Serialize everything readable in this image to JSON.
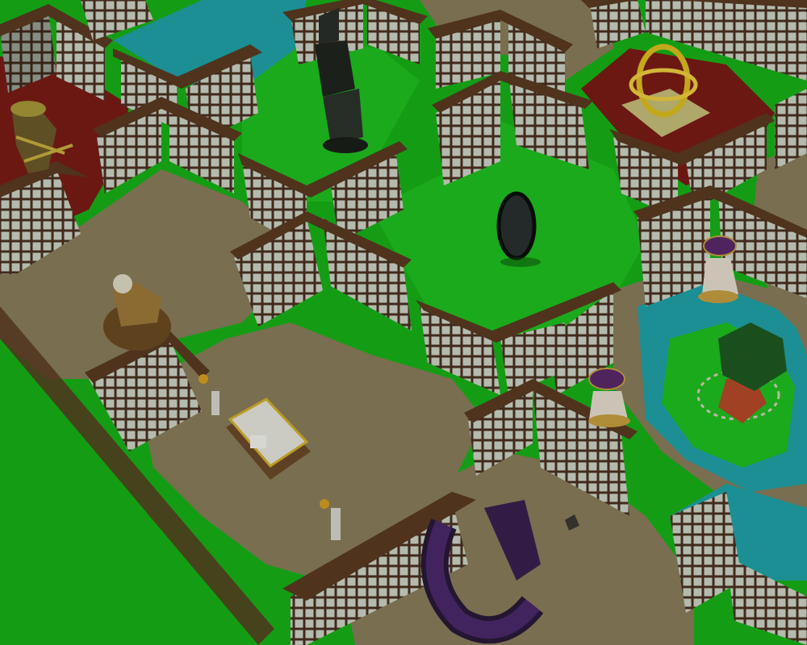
{
  "scene": {
    "view": "isometric-top-down",
    "rooms": [
      {
        "id": "red-room-west",
        "floor": "red-carpet",
        "object": "wooden-chair-statue"
      },
      {
        "id": "pool-room-north",
        "floor": "water",
        "object": null
      },
      {
        "id": "garden-room-obelisk",
        "floor": "grass",
        "object": "dark-obelisk"
      },
      {
        "id": "red-room-east",
        "floor": "red-carpet",
        "object": "golden-armillary-sphere"
      },
      {
        "id": "garden-room-mirror",
        "floor": "grass",
        "object": "dark-standing-mirror"
      },
      {
        "id": "study-room",
        "floor": "beige-stone",
        "object": "wooden-throne"
      },
      {
        "id": "workshop-room",
        "floor": "beige-stone",
        "object": "altar-table-with-lecterns"
      },
      {
        "id": "purple-room",
        "floor": "beige-stone",
        "object": "purple-horseshoe-bench"
      },
      {
        "id": "pool-garden-east",
        "floor": "water-and-grass",
        "object": "tree-with-stones"
      }
    ],
    "props": [
      "purple-birdbath-north",
      "purple-birdbath-south",
      "gold-candle-stand-north",
      "gold-candle-stand-south",
      "small-rock"
    ],
    "colors": {
      "grass": "#17b317",
      "grass_dark": "#128a12",
      "floor": "#8a7e5a",
      "carpet": "#7a1c16",
      "water": "#1fa3a8",
      "wall_cap": "#5a3b22",
      "wall_face": "#cfd6c8",
      "window_frame": "#4a3020"
    }
  }
}
